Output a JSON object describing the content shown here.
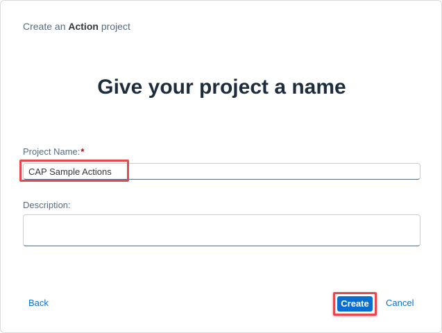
{
  "dialog": {
    "header": {
      "prefix": "Create an",
      "emphasis": "Action",
      "suffix": "project"
    },
    "heading": "Give your project a name",
    "fields": {
      "project_name": {
        "label": "Project Name:",
        "required_mark": "*",
        "value": "CAP Sample Actions"
      },
      "description": {
        "label": "Description:",
        "value": ""
      }
    },
    "footer": {
      "back_label": "Back",
      "create_label": "Create",
      "cancel_label": "Cancel"
    }
  },
  "colors": {
    "accent": "#0a6ed1",
    "highlight": "#e8474e",
    "heading": "#1d2d3e",
    "label": "#556b82",
    "required": "#aa0808"
  }
}
